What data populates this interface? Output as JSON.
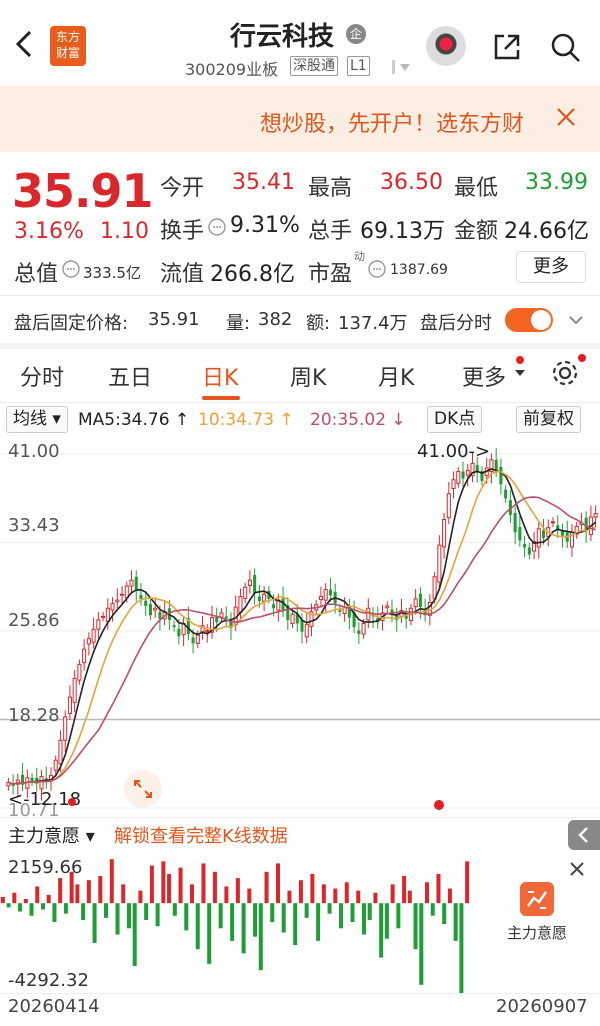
{
  "header": {
    "logo_line1": "东方",
    "logo_line2": "财富",
    "stock_name": "行云科技",
    "badge": "企",
    "code": "300209",
    "board": "业板",
    "tag_sz": "深股通",
    "tag_l1": "L1"
  },
  "banner": {
    "text": "想炒股，先开户！选东方财"
  },
  "quote": {
    "price": "35.91",
    "pct": "3.16%",
    "change": "1.10",
    "open_label": "今开",
    "open": "35.41",
    "high_label": "最高",
    "high": "36.50",
    "low_label": "最低",
    "low": "33.99",
    "turnover_label": "换手",
    "turnover": "9.31%",
    "volume_label": "总手",
    "volume": "69.13万",
    "amount_label": "金额",
    "amount": "24.66亿",
    "mktcap_label": "总值",
    "mktcap": "333.5亿",
    "float_label": "流值",
    "float": "266.8亿",
    "pe_label": "市盈",
    "pe_sup": "动",
    "pe": "1387.69",
    "more_button": "更多"
  },
  "after_hours": {
    "price_label": "盘后固定价格:",
    "price": "35.91",
    "vol_label": "量:",
    "vol": "382",
    "amt_label": "额:",
    "amt": "137.4万",
    "timeshare_label": "盘后分时"
  },
  "tabs": [
    "分时",
    "五日",
    "日K",
    "周K",
    "月K",
    "更多"
  ],
  "active_tab": "日K",
  "indicator_bar": {
    "ma_select": "均线",
    "ma5": "MA5:34.76 ↑",
    "ma10": "10:34.73 ↑",
    "ma20": "20:35.02 ↓",
    "dk_select": "DK点",
    "adjust_select": "前复权"
  },
  "chart_data": {
    "type": "candlestick",
    "y_ticks": [
      "41.00",
      "33.43",
      "25.86",
      "18.28",
      "10.71"
    ],
    "ylim": [
      10.71,
      41.0
    ],
    "max_marker": "41.00->",
    "min_marker": "<-12.18",
    "closes": [
      12.9,
      12.6,
      13.1,
      12.7,
      13.3,
      13.0,
      12.8,
      13.4,
      12.9,
      13.5,
      14.8,
      16.5,
      18.5,
      20.2,
      21.8,
      23.0,
      24.3,
      25.2,
      26.0,
      26.8,
      27.1,
      27.8,
      28.2,
      28.5,
      29.0,
      29.7,
      30.2,
      29.4,
      28.6,
      28.0,
      27.2,
      27.8,
      26.9,
      27.5,
      26.8,
      26.2,
      25.4,
      26.5,
      25.6,
      24.8,
      25.5,
      26.3,
      25.9,
      27.0,
      26.6,
      27.4,
      26.9,
      26.1,
      27.9,
      28.8,
      29.6,
      30.2,
      29.1,
      28.4,
      29.0,
      28.6,
      27.8,
      28.5,
      27.6,
      26.8,
      27.3,
      26.5,
      25.8,
      26.4,
      27.5,
      28.1,
      28.8,
      29.4,
      28.9,
      28.2,
      27.5,
      27.9,
      27.0,
      26.2,
      25.6,
      26.5,
      27.8,
      27.1,
      26.6,
      27.4,
      28.0,
      27.3,
      26.8,
      27.6,
      26.9,
      27.8,
      28.6,
      27.9,
      27.2,
      28.3,
      30.5,
      33.2,
      35.4,
      37.6,
      38.8,
      39.5,
      38.9,
      39.6,
      40.2,
      39.4,
      38.7,
      39.8,
      40.5,
      39.6,
      38.4,
      37.2,
      35.8,
      34.3,
      33.6,
      33.0,
      32.4,
      33.5,
      34.6,
      33.8,
      34.7,
      35.2,
      34.5,
      34.0,
      33.5,
      34.3,
      34.8,
      35.1,
      34.4,
      35.6,
      35.91
    ],
    "ma_colors": {
      "ma5": "#222222",
      "ma10": "#e8a23a",
      "ma20": "#b8506a"
    },
    "up_color": "#d8282c",
    "down_color": "#1f9d36"
  },
  "sub_indicator": {
    "select": "主力意愿",
    "unlock_text": "解锁查看完整K线数据",
    "y_top": "2159.66",
    "y_bottom": "-4292.32",
    "values": [
      300,
      -200,
      500,
      -400,
      200,
      -600,
      800,
      -300,
      400,
      -900,
      1200,
      -500,
      1500,
      900,
      -800,
      1100,
      -1900,
      1300,
      -700,
      2100,
      -1500,
      900,
      -1200,
      -3000,
      600,
      -800,
      1800,
      -1100,
      2000,
      1400,
      -600,
      1700,
      -1300,
      900,
      -2200,
      1900,
      -2900,
      1500,
      -1200,
      800,
      -1800,
      1200,
      -2400,
      700,
      -1600,
      -3200,
      1500,
      -900,
      1900,
      -1400,
      600,
      -2000,
      1100,
      -700,
      1400,
      -1800,
      900,
      -500,
      700,
      -1200,
      1000,
      -900,
      600,
      -1500,
      -800,
      500,
      -2600,
      -1700,
      900,
      -1200,
      1300,
      600,
      -2200,
      -3900,
      1000,
      -600,
      1400,
      -1000,
      700,
      -1800,
      -4292,
      2000
    ],
    "button_label": "主力意愿"
  },
  "footer": {
    "start_date": "20260414",
    "end_date": "20260907"
  }
}
